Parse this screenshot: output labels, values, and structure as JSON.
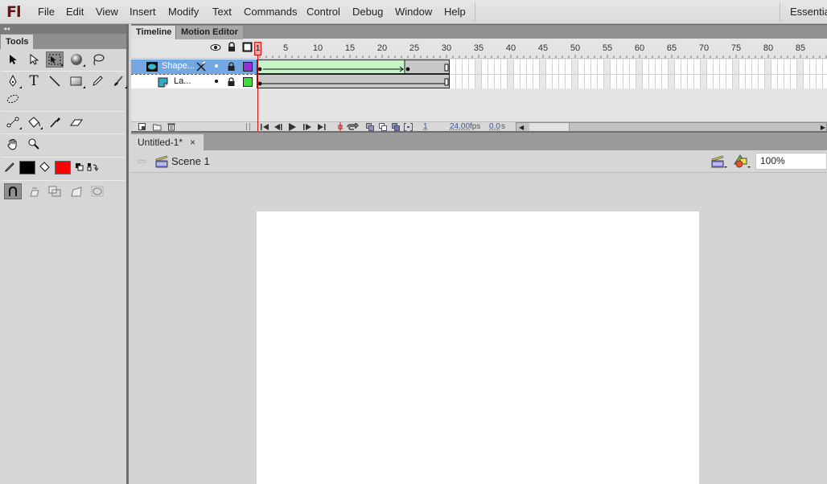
{
  "app": {
    "logo": "Fl",
    "workspace_label": "Essentials"
  },
  "menubar": {
    "items": [
      "File",
      "Edit",
      "View",
      "Insert",
      "Modify",
      "Text",
      "Commands",
      "Control",
      "Debug",
      "Window",
      "Help"
    ]
  },
  "tools_panel": {
    "collapse_glyph": "◂◂",
    "tab_label": "Tools",
    "tools": [
      {
        "name": "selection-tool",
        "glyph": "➤"
      },
      {
        "name": "subselection-tool",
        "glyph": "➢"
      },
      {
        "name": "free-transform-tool",
        "glyph": "⬚"
      },
      {
        "name": "3d-rotation-tool",
        "glyph": "●"
      },
      {
        "name": "lasso-tool",
        "glyph": "ᘓ"
      },
      {
        "name": "pen-tool",
        "glyph": "✒"
      },
      {
        "name": "text-tool",
        "glyph": "T"
      },
      {
        "name": "line-tool",
        "glyph": "╲"
      },
      {
        "name": "rectangle-tool",
        "glyph": "▭"
      },
      {
        "name": "pencil-tool",
        "glyph": "✏"
      },
      {
        "name": "brush-tool",
        "glyph": "🖌"
      },
      {
        "name": "deco-tool",
        "glyph": "❋"
      },
      {
        "name": "bone-tool",
        "glyph": "⚲"
      },
      {
        "name": "paint-bucket-tool",
        "glyph": "⛀"
      },
      {
        "name": "eyedropper-tool",
        "glyph": "⁄"
      },
      {
        "name": "eraser-tool",
        "glyph": "▱"
      },
      {
        "name": "hand-tool",
        "glyph": "✋"
      },
      {
        "name": "zoom-tool",
        "glyph": "🔍"
      }
    ],
    "stroke_color": "#000000",
    "fill_color": "#ff0000",
    "options": [
      {
        "name": "snap-to-objects-option",
        "glyph": "∩"
      },
      {
        "name": "rotate-skew-option",
        "glyph": "▱"
      },
      {
        "name": "scale-option",
        "glyph": "⧉"
      },
      {
        "name": "distort-option",
        "glyph": "◿"
      },
      {
        "name": "envelope-option",
        "glyph": "◌"
      }
    ]
  },
  "timeline": {
    "tabs": [
      "Timeline",
      "Motion Editor"
    ],
    "active_tab": "Timeline",
    "ruler_labels": [
      "1",
      "5",
      "10",
      "15",
      "20",
      "25",
      "30",
      "35",
      "40",
      "45",
      "50",
      "55",
      "60",
      "65",
      "70",
      "75",
      "80",
      "85"
    ],
    "current_frame_marker": "1",
    "layers": [
      {
        "name": "Shape...",
        "type": "shape-tween-layer",
        "selected": true,
        "color": "#9a2fd6",
        "tween_start": 1,
        "tween_end": 24,
        "last_frame": 30
      },
      {
        "name": "La...",
        "type": "normal-layer",
        "selected": false,
        "color": "#3bdc3b",
        "last_frame": 30
      }
    ],
    "footer": {
      "current_frame": "1",
      "fps_value": "24.00",
      "fps_unit": "fps",
      "elapsed_value": "0.0",
      "elapsed_unit": "s"
    }
  },
  "document": {
    "tab_title": "Untitled-1*",
    "close_glyph": "×",
    "scene_label": "Scene 1",
    "zoom_value": "100%"
  }
}
